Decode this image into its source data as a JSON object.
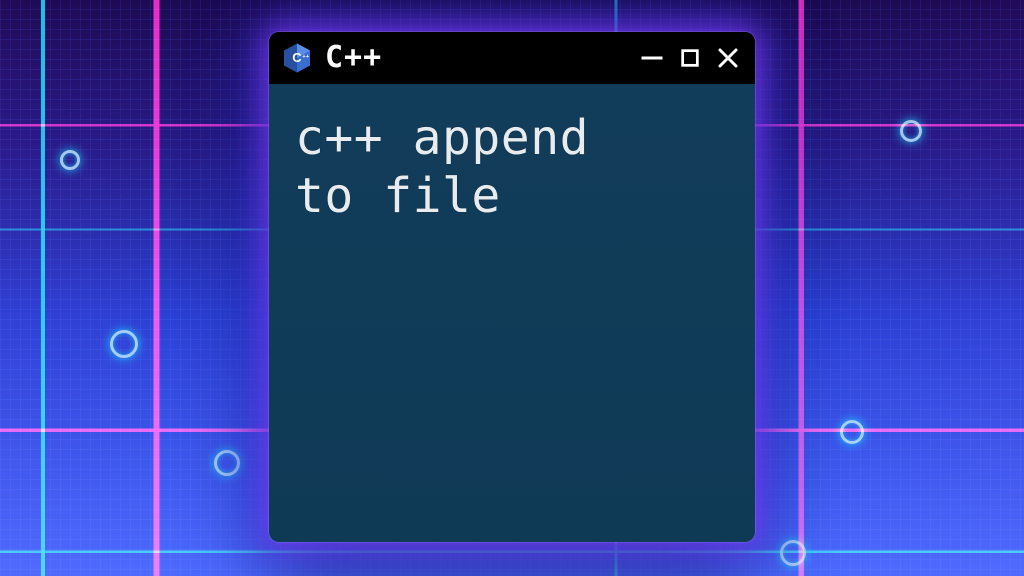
{
  "window": {
    "title": "C++",
    "icon_name": "cpp-hex-icon",
    "controls": {
      "minimize_name": "minimize-icon",
      "maximize_name": "maximize-icon",
      "close_name": "close-icon"
    }
  },
  "terminal": {
    "text": "c++ append\nto file"
  },
  "colors": {
    "titlebar_bg": "#000000",
    "terminal_bg": "#0f3a56",
    "text": "#e8ecee",
    "glow_magenta": "#ff28c8",
    "glow_cyan": "#00e6ff"
  }
}
